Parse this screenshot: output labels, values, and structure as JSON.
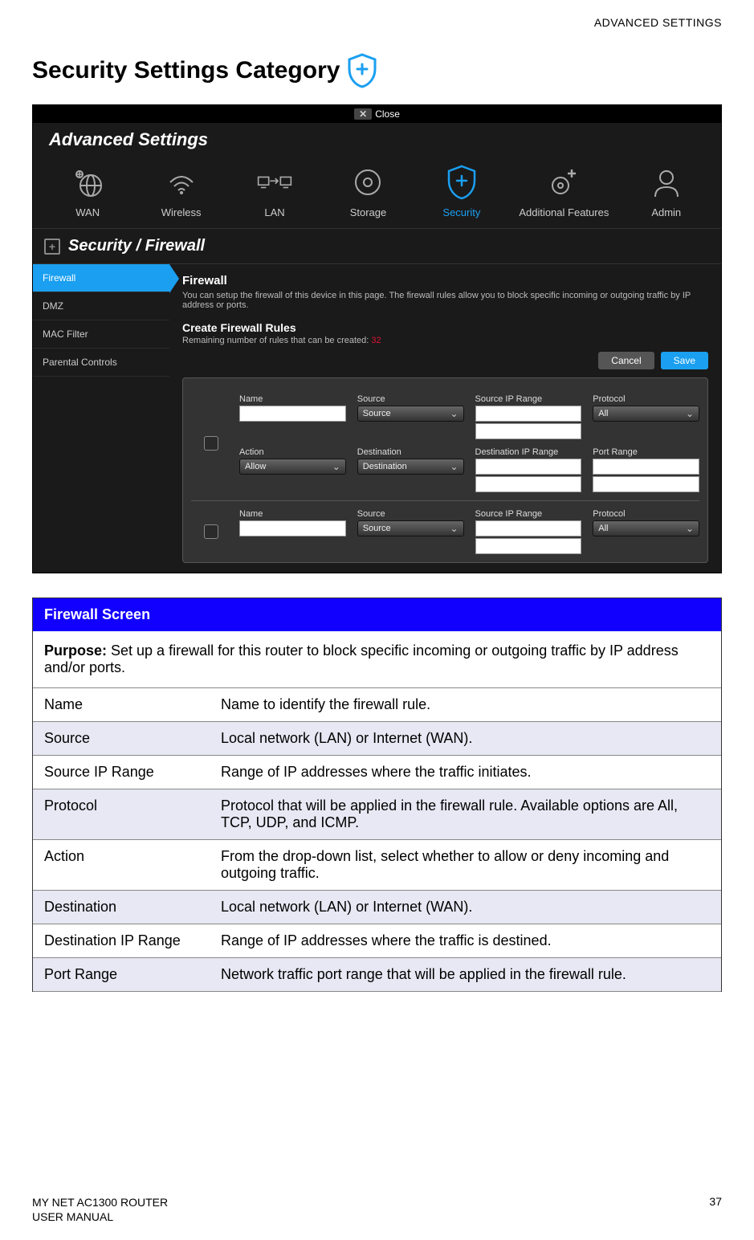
{
  "header_right": "ADVANCED SETTINGS",
  "page_title": "Security Settings Category",
  "screenshot": {
    "close_label": "Close",
    "title": "Advanced Settings",
    "nav": [
      {
        "label": "WAN"
      },
      {
        "label": "Wireless"
      },
      {
        "label": "LAN"
      },
      {
        "label": "Storage"
      },
      {
        "label": "Security"
      },
      {
        "label": "Additional Features"
      },
      {
        "label": "Admin"
      }
    ],
    "breadcrumb": "Security / Firewall",
    "sidebar": [
      {
        "label": "Firewall"
      },
      {
        "label": "DMZ"
      },
      {
        "label": "MAC Filter"
      },
      {
        "label": "Parental Controls"
      }
    ],
    "main": {
      "heading": "Firewall",
      "desc": "You can setup the firewall of this device in this page. The firewall rules allow you to block specific incoming or outgoing traffic by IP address or ports.",
      "create_heading": "Create Firewall Rules",
      "remaining_text": "Remaining number of rules that can be created:",
      "remaining_count": "32",
      "cancel": "Cancel",
      "save": "Save",
      "labels": {
        "name": "Name",
        "source": "Source",
        "source_sel": "Source",
        "source_ip": "Source IP Range",
        "protocol": "Protocol",
        "protocol_sel": "All",
        "action": "Action",
        "action_sel": "Allow",
        "destination": "Destination",
        "destination_sel": "Destination",
        "dest_ip": "Destination IP Range",
        "port_range": "Port Range"
      }
    }
  },
  "table": {
    "header": "Firewall Screen",
    "purpose_label": "Purpose:",
    "purpose_text": " Set up a firewall for this router to block specific incoming or outgoing traffic by IP address and/or ports.",
    "rows": [
      {
        "k": "Name",
        "v": "Name to identify the firewall rule."
      },
      {
        "k": "Source",
        "v": "Local network (LAN) or Internet (WAN)."
      },
      {
        "k": "Source IP Range",
        "v": "Range of IP addresses where the traffic initiates."
      },
      {
        "k": "Protocol",
        "v": "Protocol that will be applied in the firewall rule. Available options are All, TCP, UDP, and ICMP."
      },
      {
        "k": "Action",
        "v": "From the drop-down list, select whether to allow or deny incoming and outgoing traffic."
      },
      {
        "k": "Destination",
        "v": "Local network (LAN) or Internet (WAN)."
      },
      {
        "k": "Destination IP Range",
        "v": "Range of IP addresses where the traffic is destined."
      },
      {
        "k": "Port Range",
        "v": "Network traffic port range that will be applied in the firewall rule."
      }
    ]
  },
  "footer": {
    "line1": "MY NET AC1300 ROUTER",
    "line2": "USER MANUAL",
    "page": "37"
  }
}
